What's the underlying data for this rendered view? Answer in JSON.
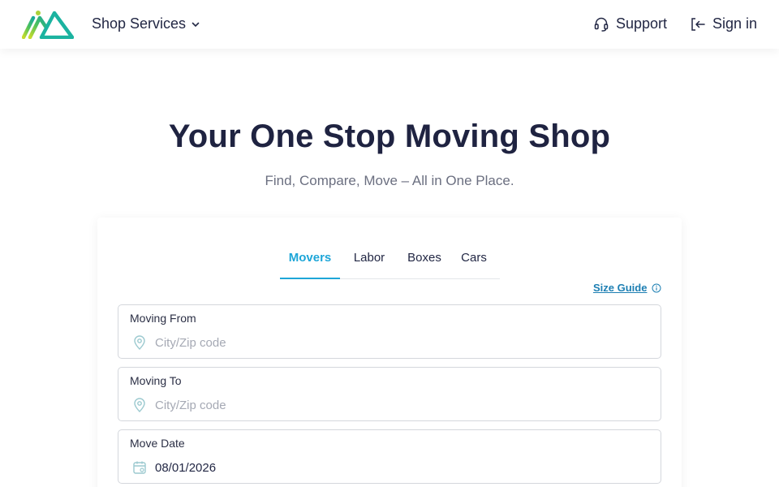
{
  "header": {
    "logo_icon": "mountain-logo-icon",
    "shop_services_label": "Shop Services",
    "support_label": "Support",
    "support_icon": "headset-icon",
    "signin_label": "Sign in",
    "signin_icon": "sign-in-icon"
  },
  "hero": {
    "title": "Your One Stop Moving Shop",
    "subtitle": "Find, Compare, Move – All in One Place."
  },
  "tabs": [
    {
      "label": "Movers",
      "active": true
    },
    {
      "label": "Labor",
      "active": false
    },
    {
      "label": "Boxes",
      "active": false
    },
    {
      "label": "Cars",
      "active": false
    }
  ],
  "size_guide": {
    "label": "Size Guide",
    "icon": "info-icon"
  },
  "form": {
    "moving_from": {
      "label": "Moving From",
      "placeholder": "City/Zip code",
      "value": "",
      "icon": "location-pin-icon"
    },
    "moving_to": {
      "label": "Moving To",
      "placeholder": "City/Zip code",
      "value": "",
      "icon": "location-pin-icon"
    },
    "move_date": {
      "label": "Move Date",
      "value": "08/01/2026",
      "icon": "calendar-icon"
    }
  },
  "colors": {
    "accent": "#1ea6d8",
    "text_dark": "#1f2341",
    "logo_green": "#5cc24a",
    "logo_teal": "#1bb3a0"
  }
}
